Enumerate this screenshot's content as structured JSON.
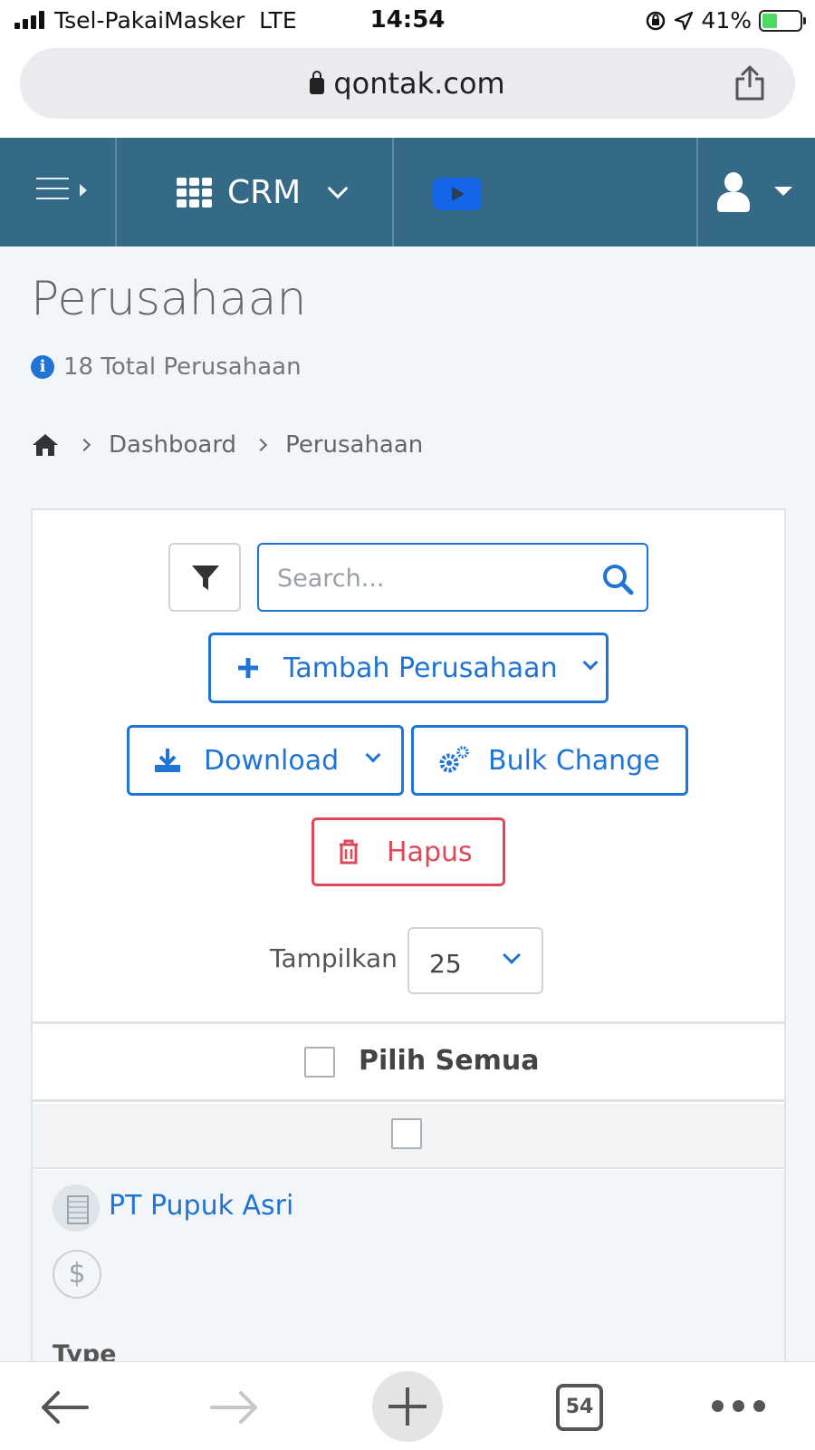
{
  "status_bar": {
    "carrier": "Tsel-PakaiMasker",
    "network": "LTE",
    "time": "14:54",
    "battery": "41%",
    "battery_level": 0.41
  },
  "browser": {
    "domain": "qontak.com"
  },
  "header": {
    "app_label": "CRM"
  },
  "page": {
    "title": "Perusahaan",
    "total": "18 Total Perusahaan"
  },
  "breadcrumb": {
    "items": [
      "Dashboard",
      "Perusahaan"
    ]
  },
  "toolbar": {
    "search_placeholder": "Search...",
    "add_label": "Tambah Perusahaan",
    "download_label": "Download",
    "bulk_label": "Bulk Change",
    "delete_label": "Hapus",
    "show_label": "Tampilkan",
    "page_size": "25"
  },
  "list": {
    "select_all_label": "Pilih Semua",
    "rows": [
      {
        "company": "PT Pupuk Asri",
        "field_label": "Type"
      }
    ]
  },
  "bottom_bar": {
    "tab_count": "54"
  },
  "colors": {
    "header_bg": "#346a86",
    "primary": "#1f74d6",
    "danger": "#e0485a",
    "youtube": "#1565e8"
  }
}
